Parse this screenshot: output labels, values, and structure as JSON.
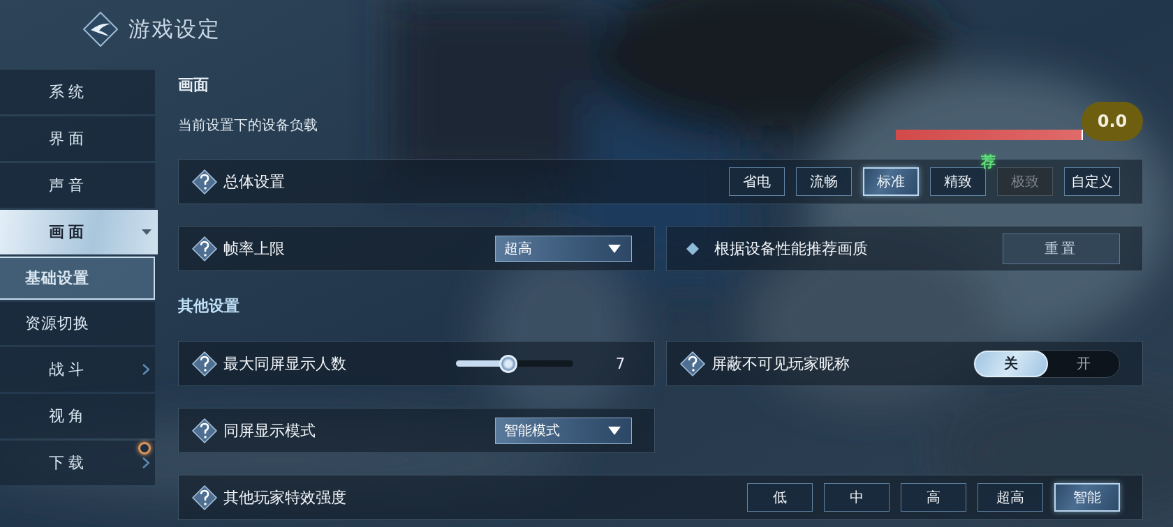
{
  "header": {
    "title": "游戏设定"
  },
  "sidebar": {
    "items": [
      {
        "label": "系统",
        "kind": "plain",
        "selected": false
      },
      {
        "label": "界面",
        "kind": "plain",
        "selected": false
      },
      {
        "label": "声音",
        "kind": "plain",
        "selected": false
      },
      {
        "label": "画面",
        "kind": "group",
        "selected": true,
        "expanded": true,
        "children": [
          {
            "label": "基础设置",
            "selected": true
          },
          {
            "label": "资源切换",
            "selected": false
          }
        ]
      },
      {
        "label": "战斗",
        "kind": "group",
        "selected": false,
        "expanded": false
      },
      {
        "label": "视角",
        "kind": "plain",
        "selected": false
      },
      {
        "label": "下载",
        "kind": "group",
        "selected": false,
        "expanded": false,
        "notification": true
      }
    ]
  },
  "sections": [
    {
      "title": "画面",
      "load": {
        "label": "当前设置下的设备负载",
        "level": 1,
        "reading": "0.0"
      },
      "rows": [
        {
          "cards": [
            {
              "kind": "options",
              "label": "总体设置",
              "options": [
                {
                  "label": "省电",
                  "selected": false,
                  "disabled": false
                },
                {
                  "label": "流畅",
                  "selected": false,
                  "disabled": false
                },
                {
                  "label": "标准",
                  "selected": true,
                  "disabled": false
                },
                {
                  "label": "精致",
                  "selected": false,
                  "disabled": false,
                  "tag": "荐"
                },
                {
                  "label": "极致",
                  "selected": false,
                  "disabled": true
                },
                {
                  "label": "自定义",
                  "selected": false,
                  "disabled": false
                }
              ]
            }
          ]
        },
        {
          "cards": [
            {
              "kind": "dropdown",
              "label": "帧率上限",
              "value": "超高"
            },
            {
              "kind": "action",
              "label": "根据设备性能推荐画质",
              "button": "重置"
            }
          ]
        }
      ]
    },
    {
      "title": "其他设置",
      "rows": [
        {
          "cards": [
            {
              "kind": "slider",
              "label": "最大同屏显示人数",
              "level": 0.45,
              "reading": "7"
            },
            {
              "kind": "toggle",
              "label": "屏蔽不可见玩家昵称",
              "options": [
                {
                  "label": "关",
                  "selected": true
                },
                {
                  "label": "开",
                  "selected": false
                }
              ]
            }
          ]
        },
        {
          "cards": [
            {
              "kind": "dropdown",
              "label": "同屏显示模式",
              "value": "智能模式"
            }
          ]
        },
        {
          "cards": [
            {
              "kind": "options",
              "label": "其他玩家特效强度",
              "options": [
                {
                  "label": "低",
                  "selected": false,
                  "disabled": false
                },
                {
                  "label": "中",
                  "selected": false,
                  "disabled": false
                },
                {
                  "label": "高",
                  "selected": false,
                  "disabled": false
                },
                {
                  "label": "超高",
                  "selected": false,
                  "disabled": false
                },
                {
                  "label": "智能",
                  "selected": true,
                  "disabled": false
                }
              ]
            }
          ]
        }
      ]
    }
  ]
}
